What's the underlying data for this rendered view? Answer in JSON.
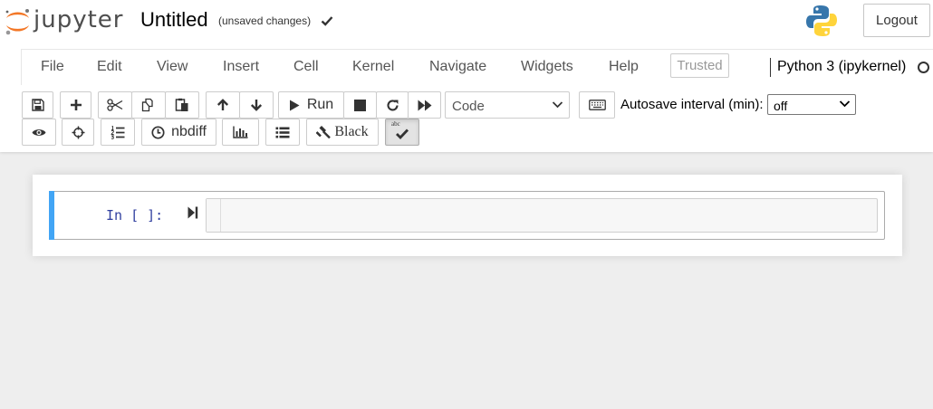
{
  "header": {
    "logo_text": "jupyter",
    "notebook_title": "Untitled",
    "save_status": "(unsaved changes)",
    "logout_label": "Logout"
  },
  "menubar": {
    "items": [
      "File",
      "Edit",
      "View",
      "Insert",
      "Cell",
      "Kernel",
      "Navigate",
      "Widgets",
      "Help"
    ],
    "trusted_label": "Trusted",
    "kernel_name": "Python 3 (ipykernel)"
  },
  "toolbar": {
    "row1": [
      {
        "name": "save-button",
        "icon": "floppy-disk-icon"
      },
      {
        "name": "insert-cell-button",
        "icon": "plus-icon"
      },
      {
        "name": "cut-button",
        "icon": "scissors-icon"
      },
      {
        "name": "copy-button",
        "icon": "copy-icon"
      },
      {
        "name": "paste-button",
        "icon": "paste-icon"
      },
      {
        "name": "move-up-button",
        "icon": "arrow-up-icon"
      },
      {
        "name": "move-down-button",
        "icon": "arrow-down-icon"
      },
      {
        "name": "run-button",
        "icon": "play-icon"
      },
      {
        "name": "interrupt-button",
        "icon": "stop-icon"
      },
      {
        "name": "restart-button",
        "icon": "refresh-icon"
      },
      {
        "name": "restart-run-all-button",
        "icon": "fast-forward-icon"
      },
      {
        "name": "command-palette-button",
        "icon": "keyboard-icon"
      }
    ],
    "run_label": "Run",
    "cell_type": "Code",
    "autosave_label": "Autosave interval (min):",
    "autosave_value": "off",
    "row2": [
      {
        "name": "variable-inspector-button",
        "icon": "eye-icon"
      },
      {
        "name": "crosshairs-button",
        "icon": "crosshairs-icon"
      },
      {
        "name": "toc-button",
        "icon": "numbered-list-icon"
      },
      {
        "name": "nbdiff-button",
        "icon": "clock-icon"
      },
      {
        "name": "chart-button",
        "icon": "bar-chart-icon"
      },
      {
        "name": "list-button",
        "icon": "list-icon"
      },
      {
        "name": "black-formatter-button",
        "icon": "gavel-icon"
      },
      {
        "name": "spellcheck-button",
        "icon": "spellcheck-icon"
      }
    ],
    "nbdiff_label": "nbdiff",
    "black_label": "Black",
    "spellcheck_label": "abc"
  },
  "cell": {
    "prompt": "In [ ]:",
    "content": ""
  },
  "colors": {
    "accent": "#42a5f5",
    "prompt": "#303f9f",
    "logo_orange": "#f37726",
    "python_blue": "#3776ab",
    "python_yellow": "#ffd43b"
  }
}
